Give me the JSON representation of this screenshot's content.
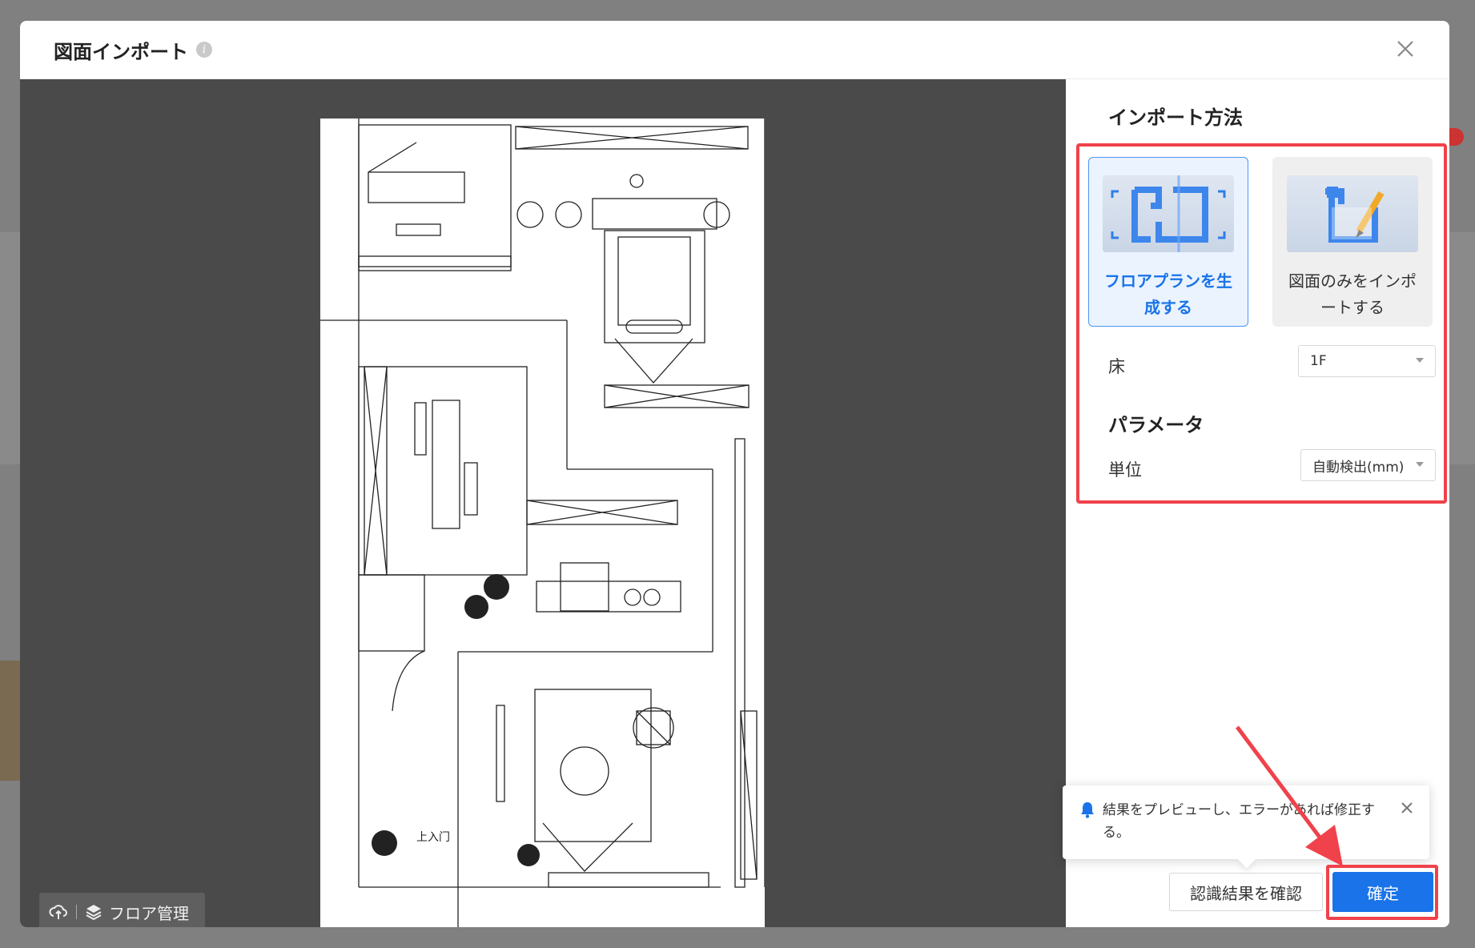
{
  "modal": {
    "title": "図面インポート"
  },
  "panel": {
    "import_method_title": "インポート方法",
    "methods": [
      {
        "label": "フロアプランを生成する",
        "selected": true
      },
      {
        "label": "図面のみをインポートする",
        "selected": false
      }
    ],
    "floor_label": "床",
    "floor_value": "1F",
    "params_title": "パラメータ",
    "unit_label": "単位",
    "unit_value": "自動検出(mm)"
  },
  "canvas": {
    "floor_button_label": "フロア管理"
  },
  "tooltip": {
    "text": "結果をプレビューし、エラーがあれば修正する。"
  },
  "footer": {
    "recognize_label": "認識結果を確認",
    "confirm_label": "確定"
  },
  "drawing_labels": {
    "entrance": "上入门"
  },
  "colors": {
    "primary": "#1a73e8",
    "highlight": "#f0424b",
    "canvas_bg": "#4a4a4a"
  }
}
